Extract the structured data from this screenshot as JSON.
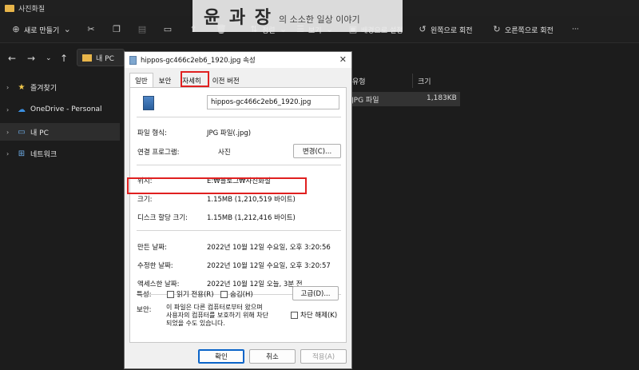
{
  "window": {
    "title": "사진화질"
  },
  "watermark": {
    "brand": "윤 과 장",
    "tagline": "의 소소한 일상 이야기"
  },
  "toolbar": {
    "new_label": "새로 만들기",
    "sort_label": "정렬",
    "view_label": "보기",
    "set_bg_label": "배경으로 설정",
    "rotate_left_label": "왼쪽으로 회전",
    "rotate_right_label": "오른쪽으로 회전",
    "more_label": "···"
  },
  "address": {
    "path": "내 PC"
  },
  "sidebar": {
    "items": [
      {
        "label": "즐겨찾기",
        "icon": "star-icon"
      },
      {
        "label": "OneDrive - Personal",
        "icon": "cloud-icon"
      },
      {
        "label": "내 PC",
        "icon": "pc-icon"
      },
      {
        "label": "네트워크",
        "icon": "network-icon"
      }
    ]
  },
  "content": {
    "columns": [
      "유형",
      "크기"
    ],
    "row": {
      "type": "JPG 파일",
      "size": "1,183KB"
    }
  },
  "dialog": {
    "title": "hippos-gc466c2eb6_1920.jpg 속성",
    "tabs": [
      "일반",
      "보안",
      "자세히",
      "이전 버전"
    ],
    "file_name": "hippos-gc466c2eb6_1920.jpg",
    "file_type_label": "파일 형식:",
    "file_type_value": "JPG 파일(.jpg)",
    "open_with_label": "연결 프로그램:",
    "open_with_value": "사진",
    "change_button": "변경(C)...",
    "location_label": "위치:",
    "location_value": "E:₩블로그₩사진화질",
    "size_label": "크기:",
    "size_value": "1.15MB (1,210,519 바이트)",
    "disk_size_label": "디스크 할당 크기:",
    "disk_size_value": "1.15MB (1,212,416 바이트)",
    "created_label": "만든 날짜:",
    "created_value": "2022년 10월 12일 수요일, 오후 3:20:56",
    "modified_label": "수정한 날짜:",
    "modified_value": "2022년 10월 12일 수요일, 오후 3:20:57",
    "accessed_label": "액세스한 날짜:",
    "accessed_value": "2022년 10월 12일 오늘, 3분 전",
    "attributes_label": "특성:",
    "readonly_label": "읽기 전용(R)",
    "hidden_label": "숨김(H)",
    "advanced_button": "고급(D)...",
    "security_label": "보안:",
    "security_note": "이 파일은 다른 컴퓨터로부터 왔으며\n사용자의 컴퓨터를 보호하기 위해 차단\n되었을 수도 있습니다.",
    "unblock_label": "차단 해제(K)",
    "ok_button": "확인",
    "cancel_button": "취소",
    "apply_button": "적용(A)"
  },
  "highlight_color": "#e02020"
}
